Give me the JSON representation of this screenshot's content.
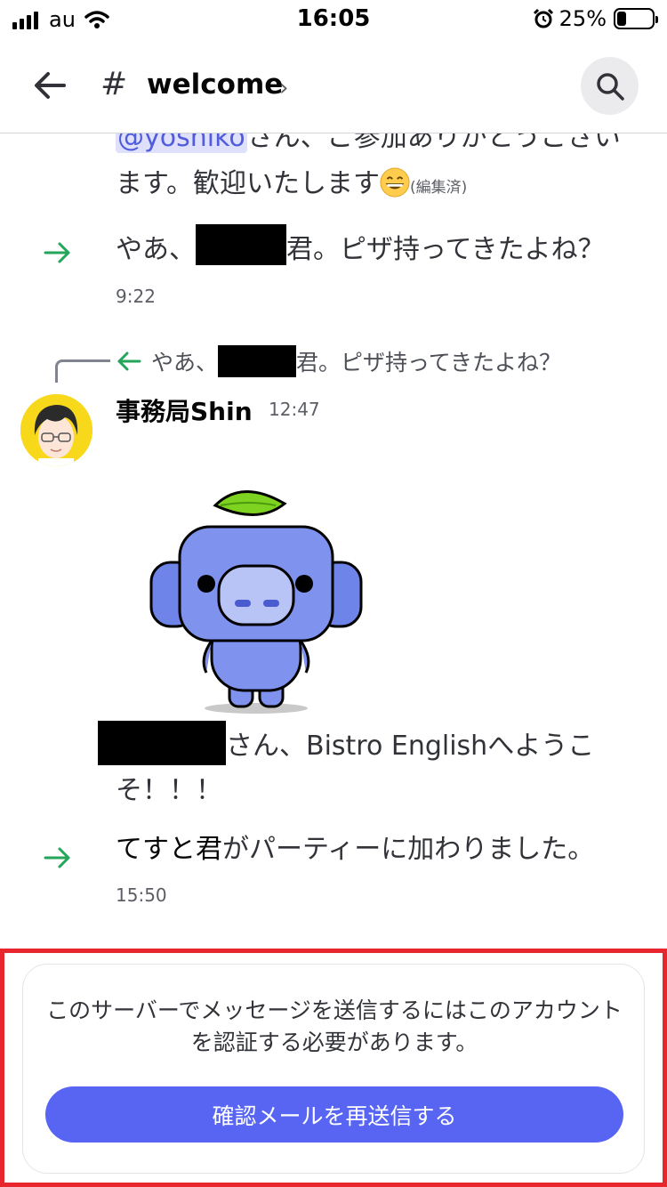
{
  "status_bar": {
    "carrier": "au",
    "time": "16:05",
    "battery_percent": "25%",
    "battery_level": 0.25,
    "icons": [
      "signal-icon",
      "wifi-icon",
      "alarm-icon",
      "battery-icon"
    ]
  },
  "header": {
    "channel_prefix": "#",
    "channel_name": "welcome",
    "chevron": "›",
    "back_icon": "arrow-left-icon",
    "search_icon": "search-icon"
  },
  "messages": {
    "top_partial": {
      "mention": "@yoshiko",
      "line1_suffix": "さん、ご参加ありがとうござい",
      "line2": "ます。歓迎いたします",
      "emoji": "grinning-face-icon",
      "edited": "(編集済)"
    },
    "join1": {
      "prefix": "やあ、",
      "suffix": "君。ピザ持ってきたよね？",
      "time": "9:22"
    },
    "reply": {
      "reply_prefix": "やあ、",
      "reply_suffix": "君。ピザ持ってきたよね？",
      "author": "事務局Shin",
      "time": "12:47",
      "caption_suffix": "さん、Bistro Englishへようこ",
      "caption_line2": "そ！！！"
    },
    "join2": {
      "name": "てすと君",
      "suffix": "がパーティーに加わりました。",
      "time": "15:50"
    }
  },
  "verify": {
    "message": "このサーバーでメッセージを送信するにはこのアカウントを認証する必要があります。",
    "button_label": "確認メールを再送信する",
    "accent": "#5865f2",
    "outline_color": "#e8262d"
  },
  "colors": {
    "join_arrow": "#23a55a",
    "text": "#313338",
    "muted": "#5c5e66"
  }
}
